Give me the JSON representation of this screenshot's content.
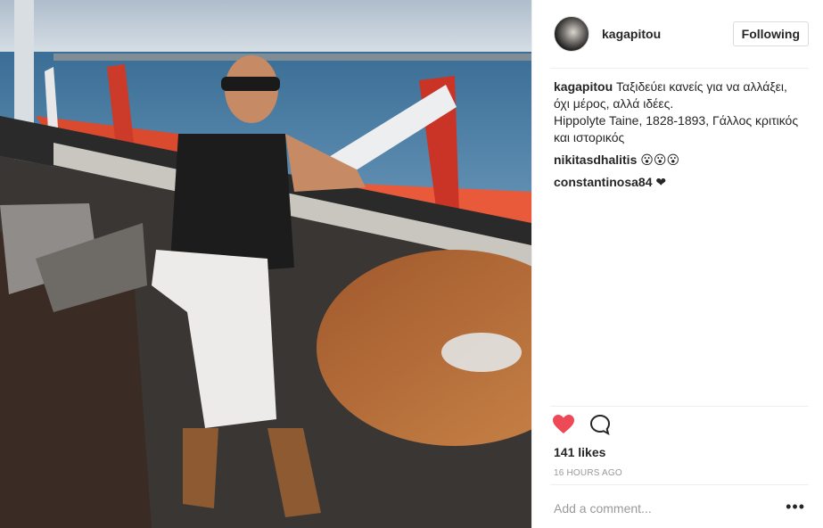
{
  "post": {
    "username": "kagapitou",
    "follow_label": "Following",
    "caption": {
      "username": "kagapitou",
      "line1": "Ταξιδεύει κανείς για να αλλάξει,",
      "line2": "όχι μέρος, αλλά ιδέες.",
      "line3": "Hippolyte Taine, 1828-1893, Γάλλος κριτικός",
      "line4": "και ιστορικός"
    },
    "comments": [
      {
        "username": "nikitasdhalitis",
        "text": "😮😮😮"
      },
      {
        "username": "constantinosa84",
        "text": "❤"
      }
    ],
    "likes": "141 likes",
    "time": "16 HOURS AGO",
    "comment_placeholder": "Add a comment...",
    "more_label": "•••"
  },
  "icons": {
    "like": "heart-icon",
    "comment": "comment-bubble-icon",
    "more": "more-options-icon"
  },
  "colors": {
    "liked_heart": "#ed4956",
    "muted_text": "#999999",
    "border": "#dbdbdb"
  }
}
